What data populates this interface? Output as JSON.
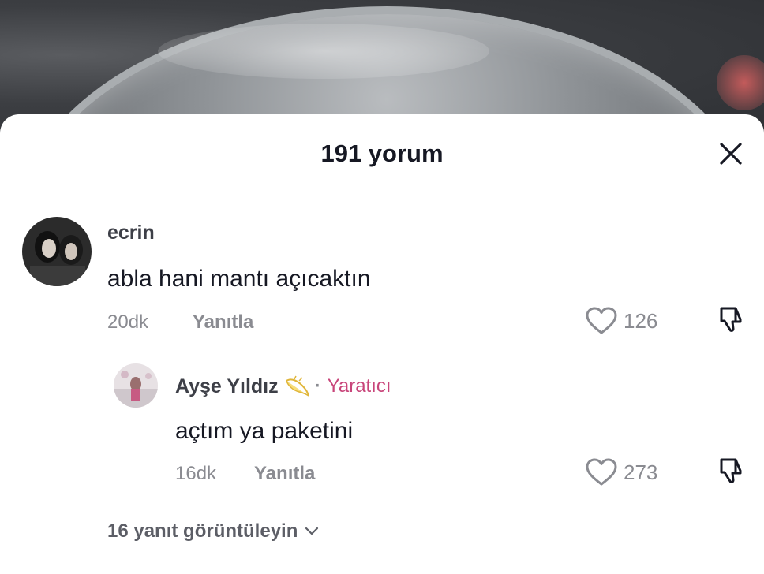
{
  "header": {
    "title": "191 yorum"
  },
  "comments": [
    {
      "username": "ecrin",
      "text": "abla hani mantı açıcaktın",
      "time": "20dk",
      "reply_label": "Yanıtla",
      "likes": "126"
    }
  ],
  "reply": {
    "username": "Ayşe Yıldız",
    "separator": "·",
    "badge": "Yaratıcı",
    "text": "açtım ya paketini",
    "time": "16dk",
    "reply_label": "Yanıtla",
    "likes": "273"
  },
  "view_replies_label": "16 yanıt görüntüleyin",
  "colors": {
    "creator_badge": "#c8457a",
    "muted": "#8a8b91",
    "text": "#161823"
  },
  "icons": [
    "close-icon",
    "heart-icon",
    "dislike-icon",
    "chevron-down-icon",
    "emoji-icon"
  ]
}
